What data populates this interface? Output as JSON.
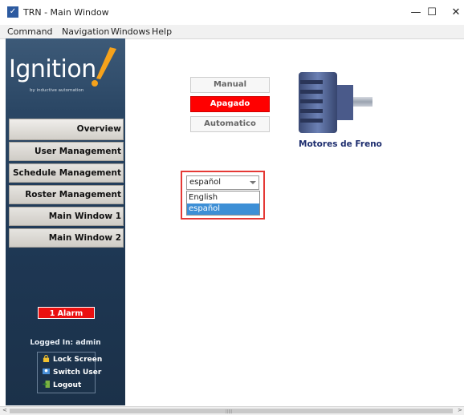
{
  "window": {
    "title": "TRN - Main Window",
    "minimize": "—",
    "maximize": "☐",
    "close": "✕"
  },
  "menubar": {
    "items": [
      "Command",
      "Navigation",
      "Windows",
      "Help"
    ]
  },
  "logo": {
    "text": "Ignition",
    "subtitle": "by inductive automation"
  },
  "nav": {
    "items": [
      "Overview",
      "User Management",
      "Schedule Management",
      "Roster Management",
      "Main Window 1",
      "Main Window 2"
    ]
  },
  "alarm": {
    "label": "1 Alarm",
    "color": "#ea1010"
  },
  "user": {
    "logged_in": "Logged In: admin",
    "actions": [
      {
        "label": "Lock Screen",
        "icon": "lock-icon"
      },
      {
        "label": "Switch User",
        "icon": "switch-user-icon"
      },
      {
        "label": "Logout",
        "icon": "logout-icon"
      }
    ]
  },
  "modes": {
    "manual": "Manual",
    "state": "Apagado",
    "automatic": "Automatico"
  },
  "motor": {
    "label": "Motores de Freno"
  },
  "language": {
    "selected": "español",
    "options": [
      "English",
      "español"
    ]
  },
  "colors": {
    "sidebar": "#1e3753",
    "state_active": "#ff0000",
    "highlight": "#e53935",
    "selection": "#3d8fd6"
  }
}
